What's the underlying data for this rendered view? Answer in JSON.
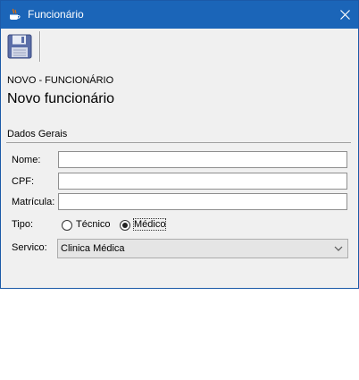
{
  "window": {
    "title": "Funcionário"
  },
  "toolbar": {
    "save_icon": "floppy-disk-icon"
  },
  "header": {
    "breadcrumb": "NOVO - FUNCIONÁRIO",
    "heading": "Novo funcionário"
  },
  "section": {
    "title": "Dados Gerais"
  },
  "form": {
    "nome_label": "Nome:",
    "nome_value": "",
    "cpf_label": "CPF:",
    "cpf_value": "",
    "matricula_label": "Matrícula:",
    "matricula_value": "",
    "tipo_label": "Tipo:",
    "tipo_options": [
      "Técnico",
      "Médico"
    ],
    "tipo_selected": "Médico",
    "servico_label": "Servico:",
    "servico_value": "Clinica Médica"
  },
  "colors": {
    "titlebar": "#1b65b8",
    "window_bg": "#f0f0f0"
  }
}
